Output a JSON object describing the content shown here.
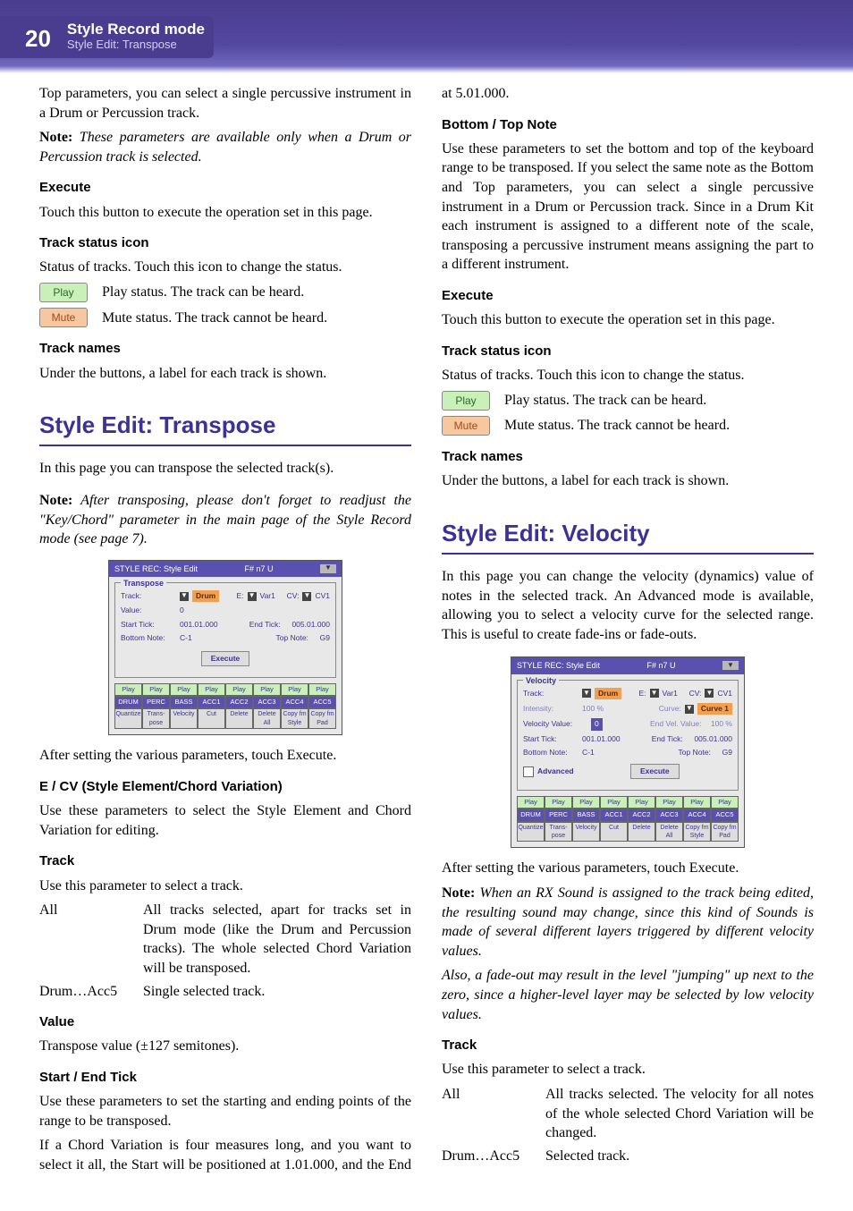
{
  "header": {
    "page": "20",
    "title": "Style Record mode",
    "sub": "Style Edit: Transpose"
  },
  "col1": {
    "intro": "Top parameters, you can select a single percussive instrument in a Drum or Percussion track.",
    "note1_label": "Note:",
    "note1": " These parameters are available only when a Drum or Percussion track is selected.",
    "exec_h": "Execute",
    "exec_t": "Touch this button to execute the operation set in this page.",
    "tsi_h": "Track status icon",
    "tsi_t": "Status of tracks. Touch this icon to change the status.",
    "play_badge": "Play",
    "play_t": "Play status. The track can be heard.",
    "mute_badge": "Mute",
    "mute_t": "Mute status. The track cannot be heard.",
    "tn_h": "Track names",
    "tn_t": "Under the buttons, a label for each track is shown."
  },
  "transpose": {
    "section": "Style Edit: Transpose",
    "p1": "In this page you can transpose the selected track(s).",
    "note_label": "Note:",
    "note": " After transposing, please don't forget to readjust the \"Key/Chord\" parameter in the main page of the Style Record mode (see page 7).",
    "after": "After setting the various parameters, touch Execute.",
    "ecv_h": "E / CV (Style Element/Chord Variation)",
    "ecv_t": "Use these parameters to select the Style Element and Chord Variation for editing.",
    "trk_h": "Track",
    "trk_t": "Use this parameter to select a track.",
    "all_term": "All",
    "all_desc": "All tracks selected, apart for tracks set in Drum mode (like the Drum and Percussion tracks). The whole selected Chord Variation will be transposed.",
    "da_term": "Drum…Acc5",
    "da_desc": "Single selected track.",
    "val_h": "Value",
    "val_t": "Transpose value (±127 semitones).",
    "set_h": "Start / End Tick",
    "set_t": "Use these parameters to set the starting and ending points of the range to be transposed."
  },
  "col2": {
    "cv": "If a Chord Variation is four measures long, and you want to select it all, the Start will be positioned at 1.01.000, and the End at 5.01.000.",
    "bt_h": "Bottom / Top Note",
    "bt_t": "Use these parameters to set the bottom and top of the keyboard range to be transposed. If you select the same note as the Bottom and Top parameters, you can select a single percussive instrument in a Drum or Percussion track. Since in a Drum Kit each instrument is assigned to a different note of the scale, transposing a percussive instrument means assigning the part to a different instrument.",
    "exec_h": "Execute",
    "exec_t": "Touch this button to execute the operation set in this page.",
    "tsi_h": "Track status icon",
    "tsi_t": "Status of tracks. Touch this icon to change the status.",
    "play_badge": "Play",
    "play_t": "Play status. The track can be heard.",
    "mute_badge": "Mute",
    "mute_t": "Mute status. The track cannot be heard.",
    "tn_h": "Track names",
    "tn_t": "Under the buttons, a label for each track is shown."
  },
  "velocity": {
    "section": "Style Edit: Velocity",
    "p1": "In this page you can change the velocity (dynamics) value of notes in the selected track. An Advanced mode is available, allowing you to select a velocity curve for the selected range. This is useful to create fade-ins or fade-outs.",
    "after": "After setting the various parameters, touch Execute.",
    "note_label": "Note:",
    "note": " When an RX Sound is assigned to the track being edited, the resulting sound may change, since this kind of Sounds is made of several different layers triggered by different velocity values.",
    "note2": "Also, a fade-out may result in the level \"jumping\" up next to the zero, since a higher-level layer may be selected by low velocity values.",
    "trk_h": "Track",
    "trk_t": "Use this parameter to select a track.",
    "all_term": "All",
    "all_desc": "All tracks selected. The velocity for all notes of the whole selected Chord Variation will be changed.",
    "da_term": "Drum…Acc5",
    "da_desc": "Selected track."
  },
  "fig": {
    "title": "STYLE REC: Style Edit",
    "info": "F# n7 U",
    "transpose": "Transpose",
    "velocity": "Velocity",
    "track": "Track:",
    "drum": "Drum",
    "e": "E:",
    "var1": "Var1",
    "cv": "CV:",
    "cv1": "CV1",
    "value": "Value:",
    "v0": "0",
    "intensity": "Intensity:",
    "i100": "100 %",
    "curve": "Curve:",
    "curve1": "Curve 1",
    "vv": "Velocity Value:",
    "vv0": "0",
    "evv": "End Vel. Value:",
    "evv100": "100   %",
    "st": "Start Tick:",
    "stv": "001.01.000",
    "et": "End Tick:",
    "etv": "005.01.000",
    "bn": "Bottom Note:",
    "bnv": "C-1",
    "tn": "Top Note:",
    "tnv": "G9",
    "advanced": "Advanced",
    "execute": "Execute",
    "play": "Play",
    "tracks": [
      "DRUM",
      "PERC",
      "BASS",
      "ACC1",
      "ACC2",
      "ACC3",
      "ACC4",
      "ACC5"
    ],
    "footer": [
      "Quantize",
      "Trans-pose",
      "Velocity",
      "Cut",
      "Delete",
      "Delete All",
      "Copy fm Style",
      "Copy fm Pad"
    ]
  }
}
